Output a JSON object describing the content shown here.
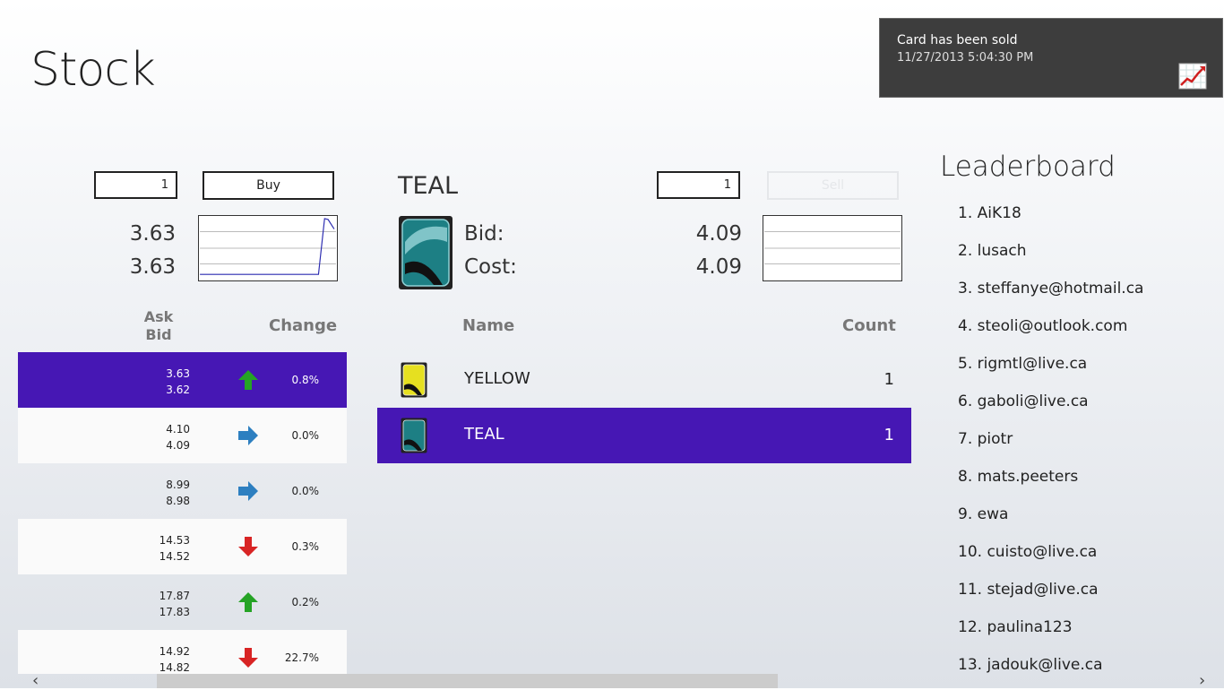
{
  "app": {
    "title": "Stock"
  },
  "toast": {
    "title": "Card has been sold",
    "timestamp": "11/27/2013 5:04:30 PM",
    "icon": "chart-up-icon"
  },
  "buy_panel": {
    "quantity": "1",
    "buy_label": "Buy",
    "ask_price": "3.63",
    "bid_price": "3.63"
  },
  "market_table": {
    "headers": {
      "ask": "Ask",
      "bid": "Bid",
      "change": "Change"
    },
    "rows": [
      {
        "ask": "3.63",
        "bid": "3.62",
        "trend": "up",
        "change": "0.8%",
        "selected": true
      },
      {
        "ask": "4.10",
        "bid": "4.09",
        "trend": "flat",
        "change": "0.0%",
        "selected": false
      },
      {
        "ask": "8.99",
        "bid": "8.98",
        "trend": "flat",
        "change": "0.0%",
        "selected": false
      },
      {
        "ask": "14.53",
        "bid": "14.52",
        "trend": "down",
        "change": "0.3%",
        "selected": false
      },
      {
        "ask": "17.87",
        "bid": "17.83",
        "trend": "up",
        "change": "0.2%",
        "selected": false
      },
      {
        "ask": "14.92",
        "bid": "14.82",
        "trend": "down",
        "change": "22.7%",
        "selected": false
      }
    ]
  },
  "card_panel": {
    "card_name": "TEAL",
    "bid_label": "Bid:",
    "cost_label": "Cost:",
    "bid_value": "4.09",
    "cost_value": "4.09",
    "quantity": "1",
    "sell_label": "Sell",
    "headers": {
      "name": "Name",
      "count": "Count"
    },
    "cards": [
      {
        "name": "YELLOW",
        "count": "1",
        "color": "#e6e020",
        "selected": false
      },
      {
        "name": "TEAL",
        "count": "1",
        "color": "#1d7f84",
        "selected": true
      }
    ]
  },
  "leaderboard": {
    "title": "Leaderboard",
    "entries": [
      "1. AiK18",
      "2. lusach",
      "3. steffanye@hotmail.ca",
      "4. steoli@outlook.com",
      "5. rigmtl@live.ca",
      "6. gaboli@live.ca",
      "7. piotr",
      "8. mats.peeters",
      "9. ewa",
      "10. cuisto@live.ca",
      "11. stejad@live.ca",
      "12. paulina123",
      "13. jadouk@live.ca"
    ]
  },
  "colors": {
    "accent": "#4617b4",
    "toast_bg": "#3d3d3d"
  }
}
